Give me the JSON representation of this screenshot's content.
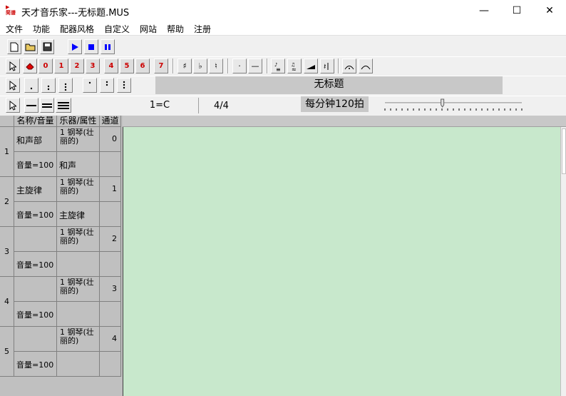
{
  "window": {
    "icon_text": "简谱",
    "title": "天才音乐家---无标题.MUS",
    "minimize": "—",
    "maximize": "☐",
    "close": "✕"
  },
  "menu": [
    "文件",
    "功能",
    "配器风格",
    "自定义",
    "网站",
    "帮助",
    "注册"
  ],
  "toolbar1": {
    "transport_colors": {
      "accent": "#0000ff"
    }
  },
  "toolbar2": {
    "numbers": [
      "0",
      "1",
      "2",
      "3",
      "4",
      "5",
      "6",
      "7"
    ],
    "sharp": "♯",
    "flat": "♭",
    "natural": "♮",
    "dot": "·",
    "dash": "—"
  },
  "toolbar3": {
    "title_value": "无标题"
  },
  "toolbar4": {
    "key": "1=C",
    "time_signature": "4/4",
    "tempo": "每分钟120拍",
    "tempo_level": 0.42
  },
  "tracks": {
    "headers": [
      "名称/音量",
      "乐器/属性",
      "通道"
    ],
    "rows": [
      {
        "num": "1",
        "name": "和声部",
        "volume": "音量=100",
        "instrument": "1 钢琴(壮丽的)",
        "attr": "和声",
        "channel": "0"
      },
      {
        "num": "2",
        "name": "主旋律",
        "volume": "音量=100",
        "instrument": "1 钢琴(壮丽的)",
        "attr": "主旋律",
        "channel": "1"
      },
      {
        "num": "3",
        "name": "",
        "volume": "音量=100",
        "instrument": "1 钢琴(壮丽的)",
        "attr": "",
        "channel": "2"
      },
      {
        "num": "4",
        "name": "",
        "volume": "音量=100",
        "instrument": "1 钢琴(壮丽的)",
        "attr": "",
        "channel": "3"
      },
      {
        "num": "5",
        "name": "",
        "volume": "音量=100",
        "instrument": "1 钢琴(壮丽的)",
        "attr": "",
        "channel": "4"
      }
    ]
  },
  "colors": {
    "staff_bg": "#c8e8cc",
    "panel_bg": "#c0c0c0",
    "number_red": "#cc0000"
  }
}
